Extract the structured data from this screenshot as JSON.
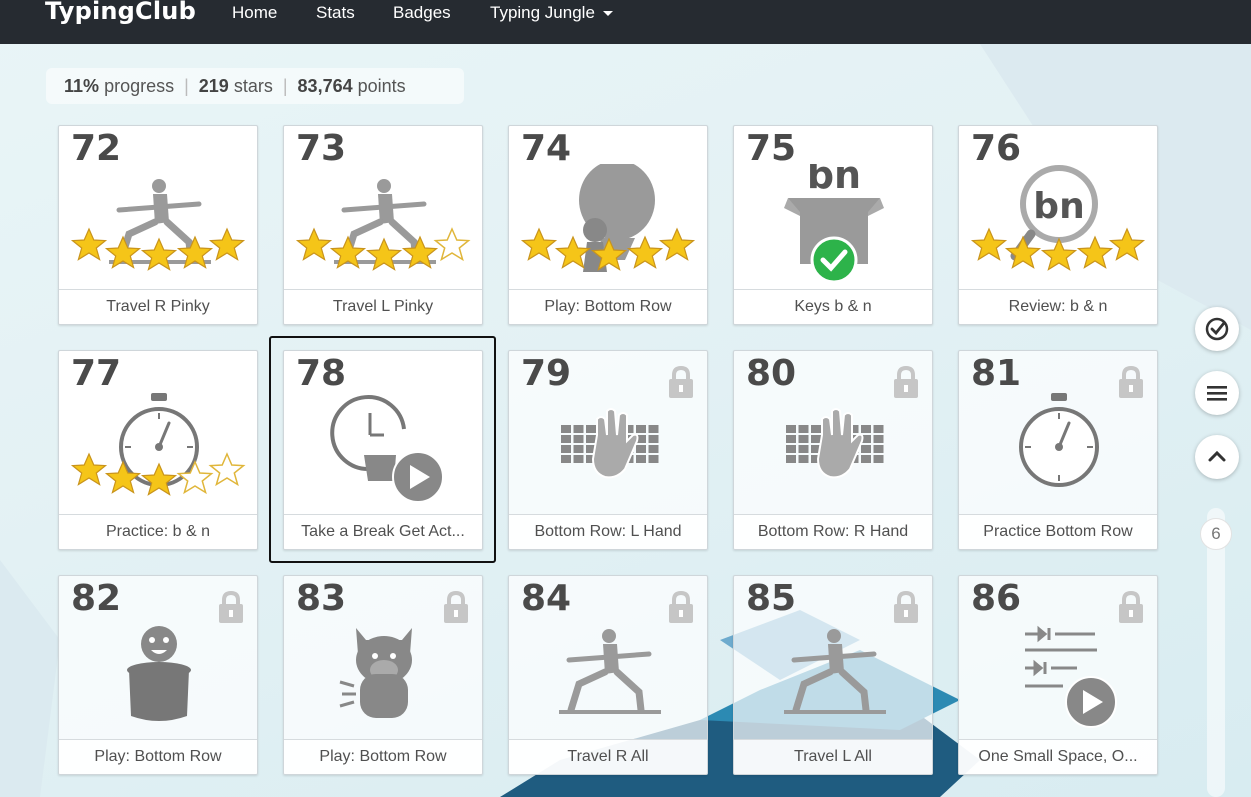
{
  "navbar": {
    "brand": "TypingClub",
    "links": [
      "Home",
      "Stats",
      "Badges",
      "Typing Jungle"
    ]
  },
  "progress": {
    "percent": "11%",
    "percent_label": "progress",
    "stars": "219",
    "stars_label": "stars",
    "points": "83,764",
    "points_label": "points"
  },
  "tiles": [
    {
      "num": "72",
      "label": "Travel R Pinky",
      "stars": 5,
      "locked": false,
      "icon": "yoga-pose-icon"
    },
    {
      "num": "73",
      "label": "Travel L Pinky",
      "stars": 4,
      "locked": false,
      "icon": "yoga-pose-icon"
    },
    {
      "num": "74",
      "label": "Play: Bottom Row",
      "stars": 5,
      "locked": false,
      "icon": "balloon-game-icon"
    },
    {
      "num": "75",
      "label": "Keys b & n",
      "stars": 0,
      "locked": false,
      "icon": "keys-box-icon",
      "icon_text": "bn"
    },
    {
      "num": "76",
      "label": "Review: b & n",
      "stars": 5,
      "locked": false,
      "icon": "magnifier-icon",
      "icon_text": "bn"
    },
    {
      "num": "77",
      "label": "Practice: b & n",
      "stars": 3,
      "locked": false,
      "icon": "stopwatch-icon"
    },
    {
      "num": "78",
      "label": "Take a Break Get Act...",
      "stars": 0,
      "locked": false,
      "icon": "break-video-icon"
    },
    {
      "num": "79",
      "label": "Bottom Row: L Hand",
      "stars": 0,
      "locked": true,
      "icon": "keyboard-hand-icon"
    },
    {
      "num": "80",
      "label": "Bottom Row: R Hand",
      "stars": 0,
      "locked": true,
      "icon": "keyboard-hand-icon"
    },
    {
      "num": "81",
      "label": "Practice Bottom Row",
      "stars": 0,
      "locked": true,
      "icon": "stopwatch-icon"
    },
    {
      "num": "82",
      "label": "Play: Bottom Row",
      "stars": 0,
      "locked": true,
      "icon": "jar-creature-icon"
    },
    {
      "num": "83",
      "label": "Play: Bottom Row",
      "stars": 0,
      "locked": true,
      "icon": "monster-icon"
    },
    {
      "num": "84",
      "label": "Travel R All",
      "stars": 0,
      "locked": true,
      "icon": "yoga-pose-icon"
    },
    {
      "num": "85",
      "label": "Travel L All",
      "stars": 0,
      "locked": true,
      "icon": "yoga-pose-icon"
    },
    {
      "num": "86",
      "label": "One Small Space, O...",
      "stars": 0,
      "locked": true,
      "icon": "spacing-video-icon"
    }
  ],
  "sidebar": {
    "buttons": [
      "check-circle-icon",
      "menu-icon",
      "chevron-up-icon"
    ],
    "page": "6"
  },
  "colors": {
    "navbar": "#262b31",
    "star": "#f5c518",
    "icon_gray": "#9a9a9a",
    "check_green": "#2db34a"
  }
}
